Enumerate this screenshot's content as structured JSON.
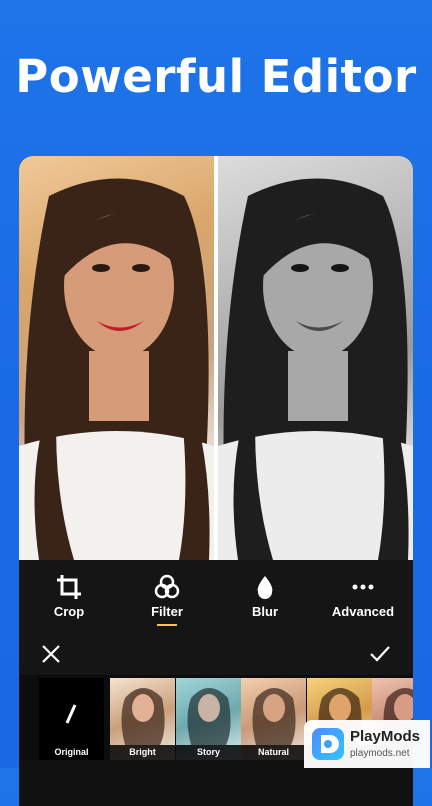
{
  "headline": "Powerful Editor",
  "tools": [
    {
      "label": "Crop",
      "icon": "crop-icon",
      "active": false
    },
    {
      "label": "Filter",
      "icon": "filter-icon",
      "active": true
    },
    {
      "label": "Blur",
      "icon": "blur-drop-icon",
      "active": false
    },
    {
      "label": "Advanced",
      "icon": "more-dots-icon",
      "active": false
    }
  ],
  "actions": {
    "close_icon": "close-icon",
    "confirm_icon": "checkmark-icon"
  },
  "filters": [
    {
      "label": "Original",
      "icon": "none-slash-icon"
    },
    {
      "label": "Bright"
    },
    {
      "label": "Story"
    },
    {
      "label": "Natural"
    },
    {
      "label": ""
    },
    {
      "label": ""
    }
  ],
  "watermark": {
    "name": "PlayMods",
    "url": "playmods.net"
  },
  "colors": {
    "background": "#1a6ae6",
    "accent_underline": "#f5c451",
    "panel": "#151515"
  }
}
